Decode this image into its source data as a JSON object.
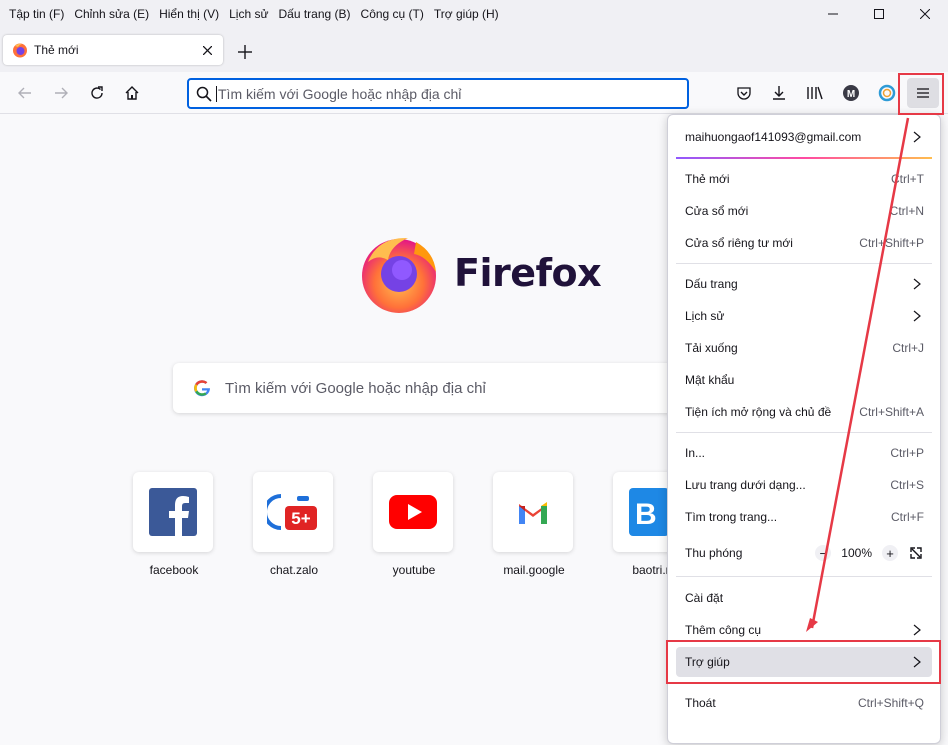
{
  "menubar": {
    "items": [
      "Tập tin (F)",
      "Chỉnh sửa (E)",
      "Hiển thị (V)",
      "Lịch sử",
      "Dấu trang (B)",
      "Công cụ (T)",
      "Trợ giúp (H)"
    ]
  },
  "tab": {
    "title": "Thẻ mới"
  },
  "urlbar": {
    "placeholder": "Tìm kiếm với Google hoặc nhập địa chỉ"
  },
  "newtab_page": {
    "brand": "Firefox",
    "search_placeholder": "Tìm kiếm với Google hoặc nhập địa chỉ",
    "top_sites": [
      {
        "label": "facebook",
        "icon": "facebook-icon"
      },
      {
        "label": "chat.zalo",
        "icon": "zalo-icon"
      },
      {
        "label": "youtube",
        "icon": "youtube-icon"
      },
      {
        "label": "mail.google",
        "icon": "gmail-icon"
      },
      {
        "label": "baotri.m",
        "icon": "baotri-icon"
      }
    ]
  },
  "app_menu": {
    "account": "maihuongaof141093@gmail.com",
    "items": [
      {
        "label": "Thẻ mới",
        "shortcut": "Ctrl+T"
      },
      {
        "label": "Cửa sổ mới",
        "shortcut": "Ctrl+N"
      },
      {
        "label": "Cửa sổ riêng tư mới",
        "shortcut": "Ctrl+Shift+P"
      },
      {
        "label": "Dấu trang",
        "shortcut": ""
      },
      {
        "label": "Lịch sử",
        "shortcut": ""
      },
      {
        "label": "Tải xuống",
        "shortcut": "Ctrl+J"
      },
      {
        "label": "Mật khẩu",
        "shortcut": ""
      },
      {
        "label": "Tiện ích mở rộng và chủ đề",
        "shortcut": "Ctrl+Shift+A"
      },
      {
        "label": "In...",
        "shortcut": "Ctrl+P"
      },
      {
        "label": "Lưu trang dưới dạng...",
        "shortcut": "Ctrl+S"
      },
      {
        "label": "Tìm trong trang...",
        "shortcut": "Ctrl+F"
      },
      {
        "label": "Thu phóng",
        "zoom": "100%",
        "minus": "−",
        "plus": "+"
      },
      {
        "label": "Cài đặt",
        "shortcut": ""
      },
      {
        "label": "Thêm công cụ",
        "shortcut": ""
      },
      {
        "label": "Trợ giúp",
        "shortcut": ""
      },
      {
        "label": "Thoát",
        "shortcut": "Ctrl+Shift+Q"
      }
    ]
  },
  "colors": {
    "accent": "#0061e0",
    "annotation": "#e63946"
  }
}
